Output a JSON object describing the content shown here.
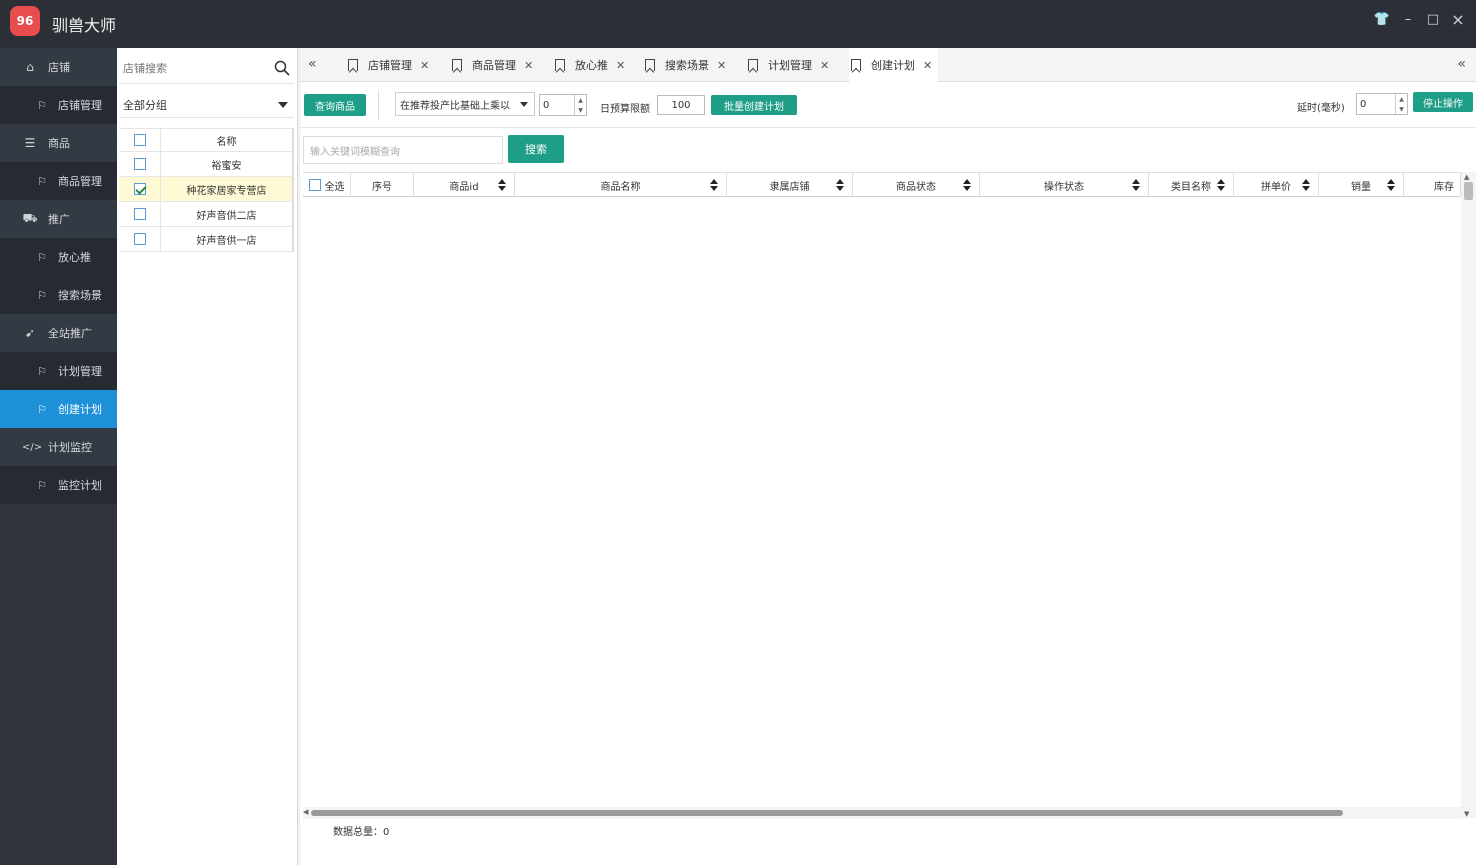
{
  "app": {
    "title": "驯兽大师",
    "logo_text": "96"
  },
  "window_controls": [
    "👕",
    "–",
    "□",
    "×"
  ],
  "nav": [
    {
      "label": "店铺",
      "icon": "home-icon",
      "type": "group"
    },
    {
      "label": "店铺管理",
      "icon": "bookmark-icon",
      "type": "sub"
    },
    {
      "label": "商品",
      "icon": "list-icon",
      "type": "group"
    },
    {
      "label": "商品管理",
      "icon": "bookmark-icon",
      "type": "sub"
    },
    {
      "label": "推广",
      "icon": "car-icon",
      "type": "group"
    },
    {
      "label": "放心推",
      "icon": "bookmark-icon",
      "type": "sub"
    },
    {
      "label": "搜索场景",
      "icon": "bookmark-icon",
      "type": "sub"
    },
    {
      "label": "全站推广",
      "icon": "rocket-icon",
      "type": "group"
    },
    {
      "label": "计划管理",
      "icon": "bookmark-icon",
      "type": "sub"
    },
    {
      "label": "创建计划",
      "icon": "bookmark-icon",
      "type": "sub",
      "active": true
    },
    {
      "label": "计划监控",
      "icon": "code-icon",
      "type": "group"
    },
    {
      "label": "监控计划",
      "icon": "bookmark-icon",
      "type": "sub"
    }
  ],
  "shop_panel": {
    "search_placeholder": "店铺搜索",
    "group_select": "全部分组",
    "name_header": "名称",
    "shops": [
      {
        "name": "裕蜜安",
        "checked": false
      },
      {
        "name": "种花家居家专营店",
        "checked": true
      },
      {
        "name": "好声音供二店",
        "checked": false
      },
      {
        "name": "好声音供一店",
        "checked": false
      }
    ]
  },
  "tabs": [
    {
      "label": "店铺管理"
    },
    {
      "label": "商品管理"
    },
    {
      "label": "放心推"
    },
    {
      "label": "搜索场景"
    },
    {
      "label": "计划管理"
    },
    {
      "label": "创建计划",
      "active": true
    }
  ],
  "toolbar": {
    "query_button": "查询商品",
    "strategy_select": "在推荐投产比基础上乘以",
    "multiplier_value": "0",
    "daily_budget_label": "日预算限额",
    "daily_budget_value": "100",
    "batch_create_button": "批量创建计划",
    "delay_label": "延时(毫秒)",
    "delay_value": "0",
    "stop_button": "停止操作"
  },
  "search": {
    "placeholder": "输入关键词模糊查询",
    "button": "搜索"
  },
  "grid": {
    "select_all": "全选",
    "columns": [
      "序号",
      "商品id",
      "商品名称",
      "隶属店铺",
      "商品状态",
      "操作状态",
      "类目名称",
      "拼单价",
      "销量",
      "库存"
    ]
  },
  "footer": {
    "total_label": "数据总量：",
    "total_value": "0"
  },
  "colors": {
    "accent_green": "#1e9e86",
    "nav_active": "#1e90d8",
    "nav_bg": "#2f343d"
  }
}
